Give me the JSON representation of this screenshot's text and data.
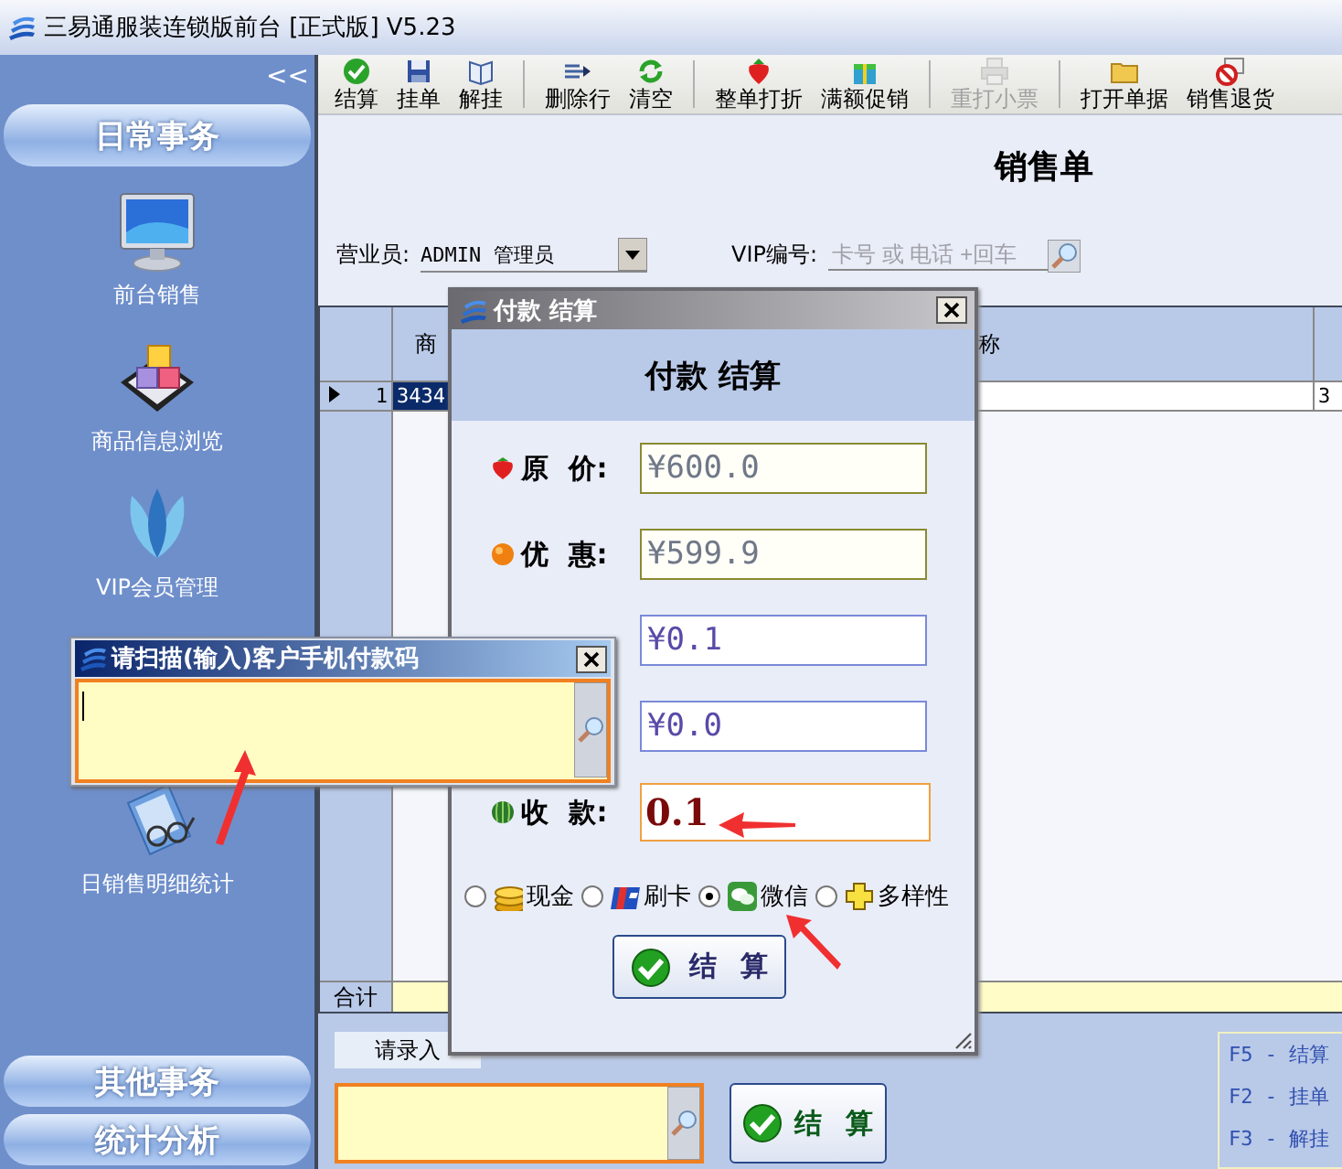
{
  "window": {
    "title": "三易通服装连锁版前台 [正式版] V5.23"
  },
  "sidebar": {
    "collapse": "<<",
    "top_group": "日常事务",
    "items": [
      {
        "label": "前台销售",
        "kind": "monitor"
      },
      {
        "label": "商品信息浏览",
        "kind": "cubes"
      },
      {
        "label": "VIP会员管理",
        "kind": "petals"
      },
      {
        "label": "日销售明细统计",
        "kind": "clipboard"
      }
    ],
    "bottom_groups": [
      "其他事务",
      "统计分析"
    ]
  },
  "toolbar": [
    [
      {
        "label": "结算",
        "kind": "check",
        "disabled": false
      },
      {
        "label": "挂单",
        "kind": "disk",
        "disabled": false
      },
      {
        "label": "解挂",
        "kind": "book",
        "disabled": false
      }
    ],
    [
      {
        "label": "删除行",
        "kind": "arrowline",
        "disabled": false
      },
      {
        "label": "清空",
        "kind": "refresh",
        "disabled": false
      }
    ],
    [
      {
        "label": "整单打折",
        "kind": "berry",
        "disabled": false
      },
      {
        "label": "满额促销",
        "kind": "gift",
        "disabled": false
      }
    ],
    [
      {
        "label": "重打小票",
        "kind": "printer",
        "disabled": true
      }
    ],
    [
      {
        "label": "打开单据",
        "kind": "folder",
        "disabled": false
      },
      {
        "label": "销售退货",
        "kind": "nosign",
        "disabled": false
      }
    ]
  ],
  "form": {
    "title": "销售单",
    "salesperson_label": "营业员:",
    "salesperson": "ADMIN 管理员",
    "vip_label": "VIP编号:",
    "vip_placeholder": "卡号 或 电话 +回车"
  },
  "table": {
    "columns": [
      "商",
      "称"
    ],
    "rows": [
      {
        "selected": true,
        "number": "1",
        "column_1": "3434",
        "column_3": "3"
      }
    ],
    "total_label": "合计"
  },
  "entry": {
    "label": "请录入",
    "button": "结 算"
  },
  "hotkeys": [
    "F5 - 结算",
    "F2 - 挂单",
    "F3 - 解挂"
  ],
  "payment_dialog": {
    "title": "付款 结算",
    "heading": "付款 结算",
    "fields": [
      {
        "label": "原 价:",
        "value": "¥600.0",
        "kind": "readonly"
      },
      {
        "label": "优 惠:",
        "value": "¥599.9",
        "kind": "readonly"
      },
      {
        "value": "¥0.1",
        "kind": "amount"
      },
      {
        "value": "¥0.0",
        "kind": "amount"
      },
      {
        "label": "收 款:",
        "value": "0.1",
        "kind": "input"
      }
    ],
    "methods": [
      {
        "label": "现金",
        "selected": false,
        "kind": "coins"
      },
      {
        "label": "刷卡",
        "selected": false,
        "kind": "card"
      },
      {
        "label": "微信",
        "selected": true,
        "kind": "chat"
      },
      {
        "label": "多样性",
        "selected": false,
        "kind": "plus"
      }
    ],
    "button": "结 算"
  },
  "scan_dialog": {
    "title": "请扫描(输入)客户手机付款码"
  }
}
